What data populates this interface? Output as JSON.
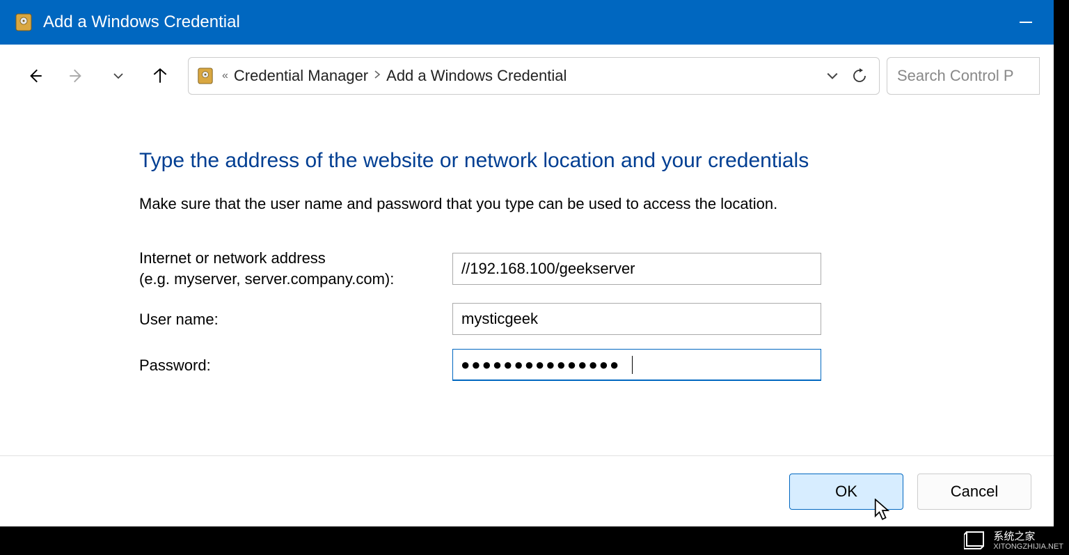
{
  "titlebar": {
    "title": "Add a Windows Credential"
  },
  "addressbar": {
    "segments_prefix": "«",
    "segment1": "Credential Manager",
    "segment2": "Add a Windows Credential"
  },
  "search": {
    "placeholder": "Search Control P"
  },
  "main": {
    "heading": "Type the address of the website or network location and your credentials",
    "hint": "Make sure that the user name and password that you type can be used to access the location.",
    "fields": {
      "address_label_line1": "Internet or network address",
      "address_label_line2": "(e.g. myserver, server.company.com):",
      "address_value": "//192.168.100/geekserver",
      "username_label": "User name:",
      "username_value": "mysticgeek",
      "password_label": "Password:",
      "password_masked": "●●●●●●●●●●●●●●●"
    }
  },
  "footer": {
    "ok_label": "OK",
    "cancel_label": "Cancel"
  },
  "watermark": {
    "brand": "系统之家",
    "url": "XITONGZHIJIA.NET"
  }
}
